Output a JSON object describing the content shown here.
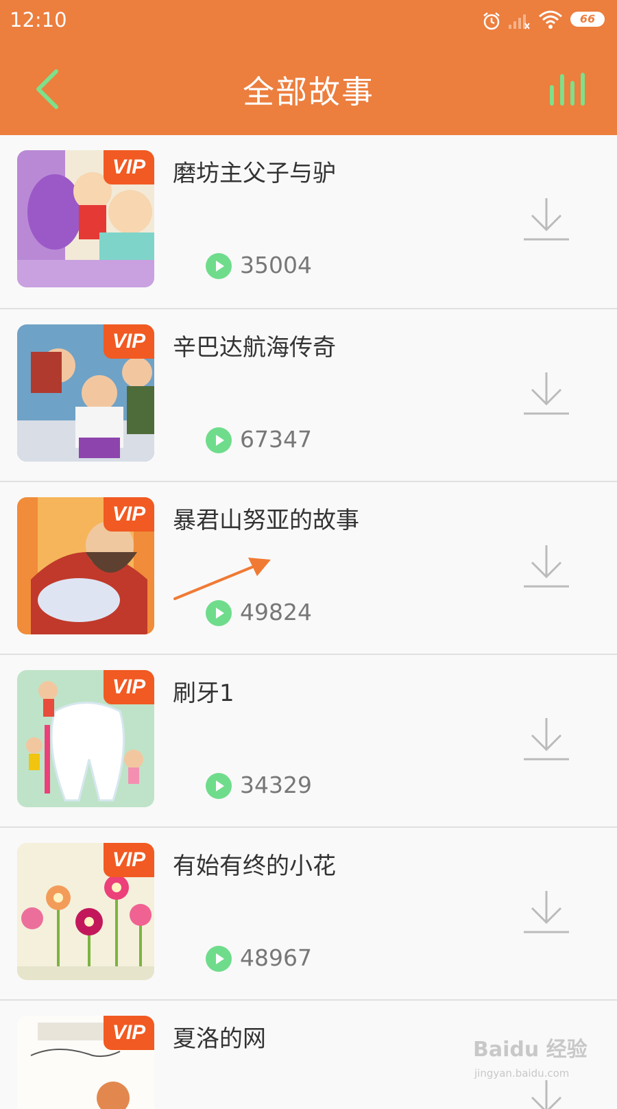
{
  "status_bar": {
    "time": "12:10",
    "battery": "66",
    "icons": [
      "alarm-icon",
      "signal-icon",
      "wifi-icon",
      "battery-icon"
    ]
  },
  "header": {
    "title": "全部故事",
    "back_icon": "chevron-left-icon",
    "playing_icon": "audio-bars-icon"
  },
  "colors": {
    "header": "#ec7e3e",
    "accent_green": "#6fdc8c",
    "vip": "#f15a22"
  },
  "stories": [
    {
      "title": "磨坊主父子与驴",
      "badge": "VIP",
      "plays": "35004"
    },
    {
      "title": "辛巴达航海传奇",
      "badge": "VIP",
      "plays": "67347"
    },
    {
      "title": "暴君山努亚的故事",
      "badge": "VIP",
      "plays": "49824"
    },
    {
      "title": "刷牙1",
      "badge": "VIP",
      "plays": "34329"
    },
    {
      "title": "有始有终的小花",
      "badge": "VIP",
      "plays": "48967"
    },
    {
      "title": "夏洛的网",
      "badge": "VIP",
      "plays": ""
    }
  ],
  "watermark": {
    "text": "Baidu 经验",
    "sub": "jingyan.baidu.com"
  }
}
